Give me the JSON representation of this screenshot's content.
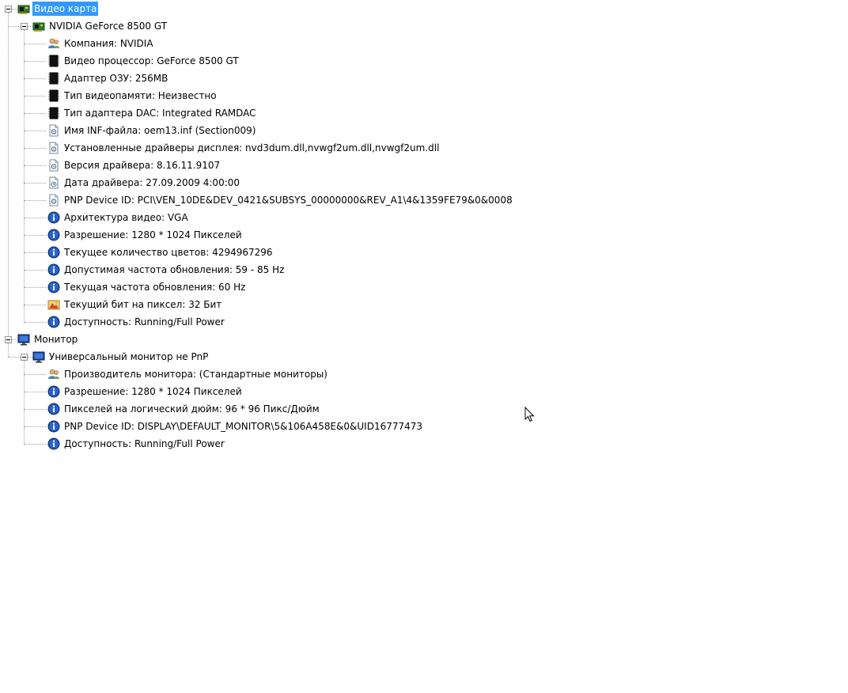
{
  "tree": {
    "video_card": {
      "label": "Видео карта",
      "device": {
        "label": "NVIDIA GeForce 8500 GT",
        "properties": [
          {
            "label": "Компания: NVIDIA",
            "icon": "company-icon"
          },
          {
            "label": "Видео процессор: GeForce 8500 GT",
            "icon": "chip-icon"
          },
          {
            "label": "Адаптер ОЗУ: 256MB",
            "icon": "chip-icon"
          },
          {
            "label": "Тип видеопамяти: Неизвестно",
            "icon": "chip-icon"
          },
          {
            "label": "Тип адаптера DAC: Integrated RAMDAC",
            "icon": "chip-icon"
          },
          {
            "label": "Имя INF-файла: oem13.inf (Section009)",
            "icon": "file-gear-icon"
          },
          {
            "label": "Установленные драйверы дисплея: nvd3dum.dll,nvwgf2um.dll,nvwgf2um.dll",
            "icon": "file-gear-icon"
          },
          {
            "label": "Версия драйвера: 8.16.11.9107",
            "icon": "file-gear-icon"
          },
          {
            "label": "Дата драйвера: 27.09.2009 4:00:00",
            "icon": "file-clock-icon"
          },
          {
            "label": "PNP Device ID: PCI\\VEN_10DE&DEV_0421&SUBSYS_00000000&REV_A1\\4&1359FE79&0&0008",
            "icon": "file-gear-icon"
          },
          {
            "label": "Архитектура видео: VGA",
            "icon": "info-icon"
          },
          {
            "label": "Разрешение: 1280 * 1024 Пикселей",
            "icon": "info-icon"
          },
          {
            "label": "Текущее количество цветов: 4294967296",
            "icon": "info-icon"
          },
          {
            "label": "Допустимая частота обновления: 59 - 85 Hz",
            "icon": "info-icon"
          },
          {
            "label": "Текущая частота обновления: 60 Hz",
            "icon": "info-icon"
          },
          {
            "label": "Текущий бит на пиксел: 32 Бит",
            "icon": "palette-icon"
          },
          {
            "label": "Доступность: Running/Full Power",
            "icon": "info-icon"
          }
        ]
      }
    },
    "monitor": {
      "label": "Монитор",
      "device": {
        "label": "Универсальный монитор не PnP",
        "properties": [
          {
            "label": "Производитель монитора: (Стандартные мониторы)",
            "icon": "company-icon"
          },
          {
            "label": "Разрешение: 1280 * 1024 Пикселей",
            "icon": "info-icon"
          },
          {
            "label": "Пикселей на логический дюйм: 96 * 96 Пикс/Дюйм",
            "icon": "info-icon"
          },
          {
            "label": "PNP Device ID: DISPLAY\\DEFAULT_MONITOR\\5&106A458E&0&UID16777473",
            "icon": "info-icon"
          },
          {
            "label": "Доступность: Running/Full Power",
            "icon": "info-icon"
          }
        ]
      }
    }
  },
  "colors": {
    "selection": "#3399ff",
    "connector": "#a0a0a0",
    "info_blue": "#1f4fa8"
  }
}
